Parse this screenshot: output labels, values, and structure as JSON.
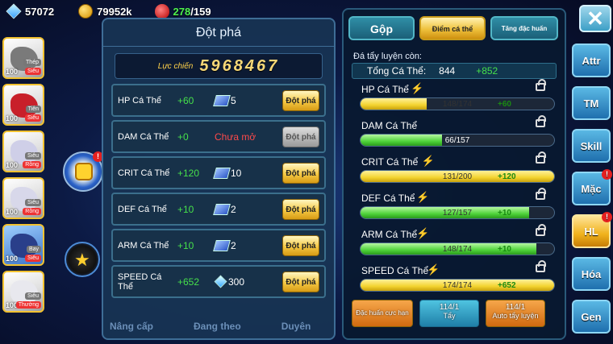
{
  "topbar": {
    "gems": "57072",
    "gold": "79952k",
    "stamina_current": "278",
    "stamina_sep": "/",
    "stamina_max": "159"
  },
  "side_list": [
    {
      "level": "100",
      "tag_top": "Thép",
      "tag": "Siêu",
      "color": "#7a7a7a"
    },
    {
      "level": "100",
      "tag_top": "Tiên",
      "tag": "Siêu",
      "color": "#c8202a"
    },
    {
      "level": "100",
      "tag_top": "Siêu",
      "tag": "Rồng",
      "color": "#cfcfe8"
    },
    {
      "level": "100",
      "tag_top": "Siêu",
      "tag": "Rồng",
      "color": "#d8d8ea"
    },
    {
      "level": "100",
      "tag_top": "Bay",
      "tag": "Siêu",
      "color": "#2a3f8a"
    },
    {
      "level": "100",
      "tag_top": "Siêu",
      "tag": "Thường",
      "color": "#e8e8ee"
    }
  ],
  "dot_pha": {
    "title": "Đột phá",
    "power_label": "Lực chiến",
    "power_value": "5968467",
    "rows": [
      {
        "name": "HP Cá Thể",
        "plus": "+60",
        "cost": "5",
        "cost_icon": "ticket-icon",
        "button": "Đột phá",
        "enabled": true
      },
      {
        "name": "DAM Cá Thể",
        "plus": "+0",
        "locked_text": "Chưa mở",
        "button": "Đột phá",
        "enabled": false
      },
      {
        "name": "CRIT Cá Thể",
        "plus": "+120",
        "cost": "10",
        "cost_icon": "ticket-icon",
        "button": "Đột phá",
        "enabled": true
      },
      {
        "name": "DEF Cá Thể",
        "plus": "+10",
        "cost": "2",
        "cost_icon": "ticket-icon",
        "button": "Đột phá",
        "enabled": true
      },
      {
        "name": "ARM Cá Thể",
        "plus": "+10",
        "cost": "2",
        "cost_icon": "ticket-icon",
        "button": "Đột phá",
        "enabled": true
      },
      {
        "name": "SPEED Cá Thể",
        "plus": "+652",
        "cost": "300",
        "cost_icon": "diamond-icon",
        "button": "Đột phá",
        "enabled": true
      }
    ]
  },
  "bottom_tabs": [
    "Nâng cấp",
    "Đang theo",
    "Duyên"
  ],
  "hl_panel": {
    "tabs": [
      "Gộp",
      "Điểm cá thể",
      "Tăng đặc huấn"
    ],
    "remain_label": "Đá tẩy luyện còn:",
    "total_label": "Tổng Cá Thể:",
    "total_value": "844",
    "total_plus": "+852",
    "stats": [
      {
        "name": "HP Cá Thể",
        "current": "148",
        "max": "174",
        "text": "148/174",
        "bonus": "+60",
        "fill": 0.34,
        "fill_color": "yellow",
        "bolt": true
      },
      {
        "name": "DAM Cá Thể",
        "current": "66",
        "max": "157",
        "text": "66/157",
        "bonus": "",
        "fill": 0.42,
        "fill_color": "green",
        "bolt": false
      },
      {
        "name": "CRIT Cá Thể",
        "current": "131",
        "max": "200",
        "text": "131/200",
        "bonus": "+120",
        "fill": 1.0,
        "fill_color": "yellow",
        "bolt": true
      },
      {
        "name": "DEF Cá Thể",
        "current": "127",
        "max": "157",
        "text": "127/157",
        "bonus": "+10",
        "fill": 0.87,
        "fill_color": "green",
        "bolt": true
      },
      {
        "name": "ARM Cá Thể",
        "current": "148",
        "max": "174",
        "text": "148/174",
        "bonus": "+10",
        "fill": 0.91,
        "fill_color": "green",
        "bolt": true
      },
      {
        "name": "SPEED Cá Thể",
        "current": "174",
        "max": "174",
        "text": "174/174",
        "bonus": "+652",
        "fill": 1.0,
        "fill_color": "yellow",
        "bolt": true
      }
    ],
    "buttons": {
      "special": "Đặc huấn cực hạn",
      "wash_count": "114/1",
      "wash_label": "Tẩy",
      "auto_count": "114/1",
      "auto_label": "Auto tẩy luyện"
    }
  },
  "nav": [
    {
      "label": "Attr",
      "active": false,
      "badge": false
    },
    {
      "label": "TM",
      "active": false,
      "badge": false
    },
    {
      "label": "Skill",
      "active": false,
      "badge": false
    },
    {
      "label": "Mặc",
      "active": false,
      "badge": true
    },
    {
      "label": "HL",
      "active": true,
      "badge": true
    },
    {
      "label": "Hóa",
      "active": false,
      "badge": false
    },
    {
      "label": "Gen",
      "active": false,
      "badge": false
    }
  ],
  "close_symbol": "✕",
  "badge_symbol": "!"
}
